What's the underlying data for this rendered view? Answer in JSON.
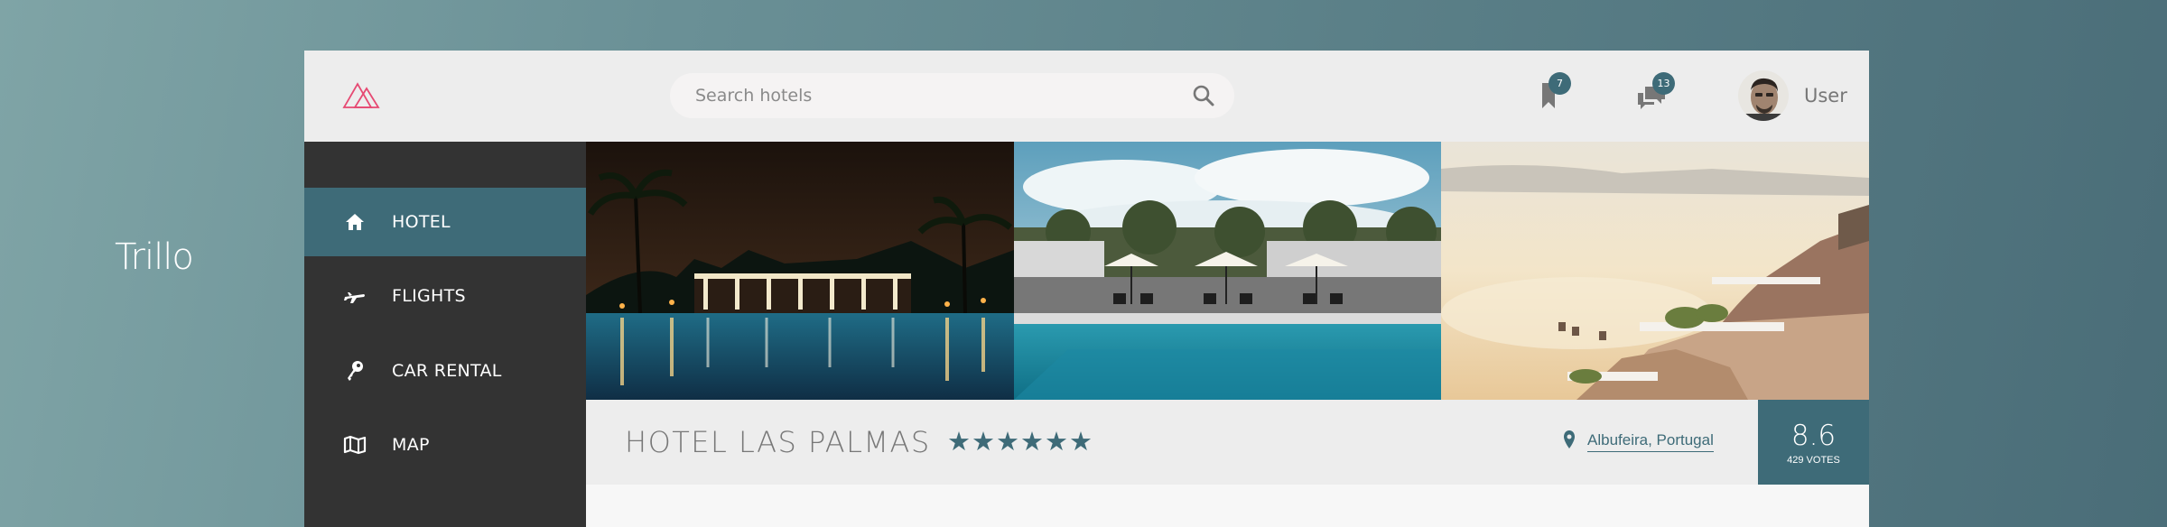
{
  "page_title": "Trillo",
  "header": {
    "logo_icon": "trillo-logo-icon",
    "search": {
      "placeholder": "Search hotels",
      "icon": "search-icon"
    },
    "bookmarks": {
      "icon": "bookmark-icon",
      "count": "7"
    },
    "messages": {
      "icon": "chat-icon",
      "count": "13"
    },
    "user": {
      "name": "User",
      "avatar": "user-avatar"
    }
  },
  "sidebar": {
    "items": [
      {
        "label": "HOTEL",
        "icon": "home-icon",
        "active": true
      },
      {
        "label": "FLIGHTS",
        "icon": "aircraft-icon",
        "active": false
      },
      {
        "label": "CAR RENTAL",
        "icon": "key-icon",
        "active": false
      },
      {
        "label": "MAP",
        "icon": "map-icon",
        "active": false
      }
    ]
  },
  "gallery": [
    {
      "name": "hotel-photo-1",
      "desc": "night pool"
    },
    {
      "name": "hotel-photo-2",
      "desc": "pool with umbrellas"
    },
    {
      "name": "hotel-photo-3",
      "desc": "cliffside terrace"
    }
  ],
  "overview": {
    "hotel_name": "HOTEL LAS PALMAS",
    "stars": 6,
    "location": "Albufeira, Portugal",
    "rating": {
      "average": "8.6",
      "count": "429 VOTES"
    }
  },
  "colors": {
    "primary": "#3e6b78",
    "logo": "#e64a73",
    "sidebar_bg": "#333333",
    "header_bg": "#ededed"
  }
}
